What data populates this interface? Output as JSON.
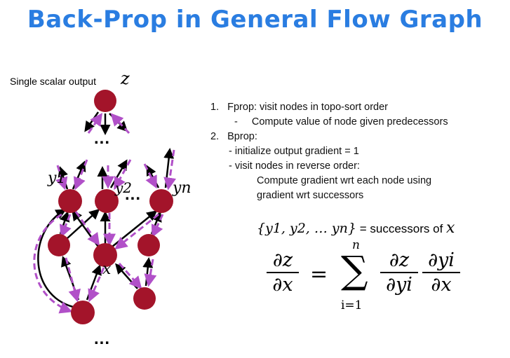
{
  "title": "Back-Prop in General Flow Graph",
  "output_label": "Single scalar output",
  "z_symbol": "z",
  "dots": "...",
  "node_labels": {
    "y1": "y1",
    "y2": "y2",
    "yn": "yn",
    "x": "x"
  },
  "steps": {
    "s1_num": "1.",
    "s1": "Fprop: visit nodes in topo-sort order",
    "s1_sub_bullet": "-",
    "s1_sub": "Compute value of node given predecessors",
    "s2_num": "2.",
    "s2": "Bprop:",
    "s2_sub1": "- initialize output gradient = 1",
    "s2_sub2": "- visit nodes in reverse order:",
    "s2_sub3a": "Compute gradient wrt each node using",
    "s2_sub3b": "gradient wrt successors"
  },
  "successors": {
    "set": "{y1, y2, … yn}",
    "text": " = successors of ",
    "x": "x"
  },
  "formula": {
    "lhs_num": "∂z",
    "lhs_den": "∂x",
    "equals": "=",
    "sum": "∑",
    "upper": "n",
    "lower": "i=1",
    "f1_num": "∂z",
    "f1_den": "∂yi",
    "f2_num": "∂yi",
    "f2_den": "∂x"
  },
  "colors": {
    "title": "#2a7de1",
    "node": "#a3142a",
    "forward_arrow": "#000000",
    "backward_arrow": "#b150c8"
  }
}
